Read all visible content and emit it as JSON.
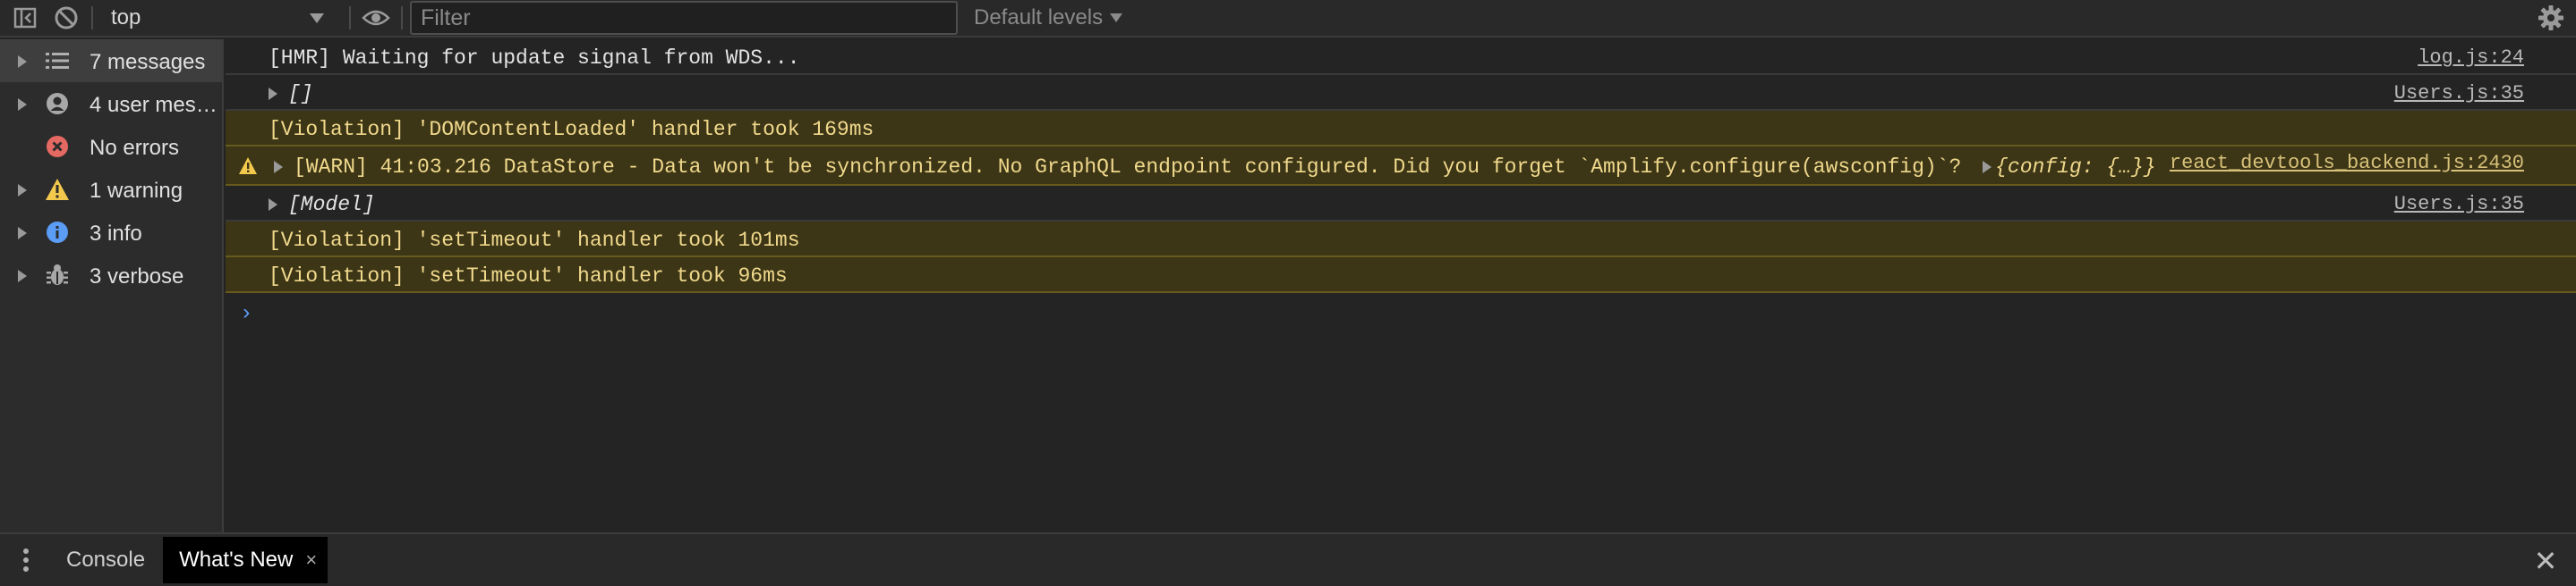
{
  "toolbar": {
    "context": "top",
    "filter_placeholder": "Filter",
    "levels_label": "Default levels"
  },
  "sidebar": {
    "items": [
      {
        "label": "7 messages",
        "icon": "list-icon"
      },
      {
        "label": "4 user mes…",
        "icon": "user-icon"
      },
      {
        "label": "No errors",
        "icon": "error-icon"
      },
      {
        "label": "1 warning",
        "icon": "warning-icon"
      },
      {
        "label": "3 info",
        "icon": "info-icon"
      },
      {
        "label": "3 verbose",
        "icon": "bug-icon"
      }
    ]
  },
  "messages": [
    {
      "text": "[HMR] Waiting for update signal from WDS...",
      "source": "log.js:24"
    },
    {
      "text": "[]",
      "source": "Users.js:35"
    },
    {
      "text": "[Violation] 'DOMContentLoaded' handler took 169ms"
    },
    {
      "text": "[WARN] 41:03.216 DataStore - Data won't be synchronized. No GraphQL endpoint configured. Did you forget `Amplify.configure(awsconfig)`?",
      "object": "{config: {…}}",
      "source": "react_devtools_backend.js:2430"
    },
    {
      "text": "[Model]",
      "source": "Users.js:35"
    },
    {
      "text": "[Violation] 'setTimeout' handler took 101ms"
    },
    {
      "text": "[Violation] 'setTimeout' handler took 96ms"
    }
  ],
  "prompt": "›",
  "drawer": {
    "tabs": [
      {
        "label": "Console"
      },
      {
        "label": "What's New"
      }
    ],
    "tab_close": "×",
    "close": "✕"
  },
  "colors": {
    "background": "#242424",
    "violation_bg": "#3c3516",
    "violation_text": "#f0d98c",
    "error_red": "#e46962",
    "warning_yellow": "#f2c94c",
    "info_blue": "#5b9cf5"
  }
}
